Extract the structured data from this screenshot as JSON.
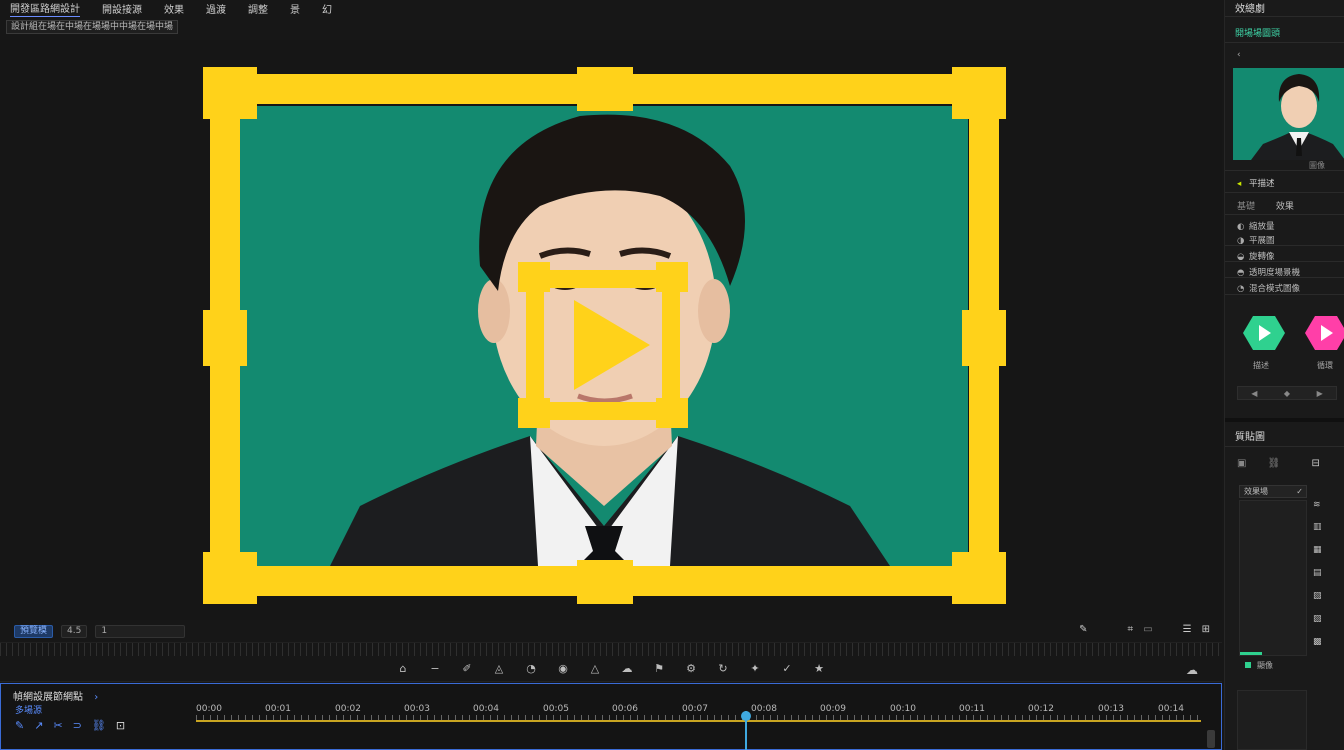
{
  "menu": {
    "items": [
      "開發區路網設計",
      "開設接源",
      "效果",
      "過渡",
      "調整",
      "景",
      "幻"
    ]
  },
  "subbar": {
    "label": "設計組在場在中場在場場中中場在場中場"
  },
  "transport": {
    "mode": "預覽模",
    "time": "4.5",
    "rate": "1"
  },
  "timeline": {
    "title": "幀網設展節網點",
    "sub": "多場源",
    "ruler": [
      "00:00",
      "00:01",
      "00:02",
      "00:03",
      "00:04",
      "00:05",
      "00:06",
      "00:07",
      "00:08",
      "00:09",
      "00:10",
      "00:11",
      "00:12",
      "00:13",
      "00:14"
    ]
  },
  "right_panel": {
    "title": "效總劇",
    "tab": "開場場圖頭",
    "back": "‹",
    "thumb_label": "圖像",
    "props_header": "平描述",
    "tabs": [
      "基礎",
      "效果"
    ],
    "props": [
      "縮放量",
      "平展圖",
      "旋轉像",
      "透明度場景機",
      "混合模式圖像"
    ],
    "fx": [
      {
        "label": "描述",
        "color": "#2fd18f"
      },
      {
        "label": "循環",
        "color": "#ff3fa8"
      }
    ],
    "mini": [
      "◀",
      "◆",
      "▶"
    ],
    "section2_title": "質貼圖",
    "section2_select": "效果場",
    "section2_foot": "顯像"
  },
  "colors": {
    "frame": "#ffd21a",
    "backdrop": "#138a70",
    "accent": "#3fa9e0",
    "timeline_border": "#3a6bd6"
  }
}
